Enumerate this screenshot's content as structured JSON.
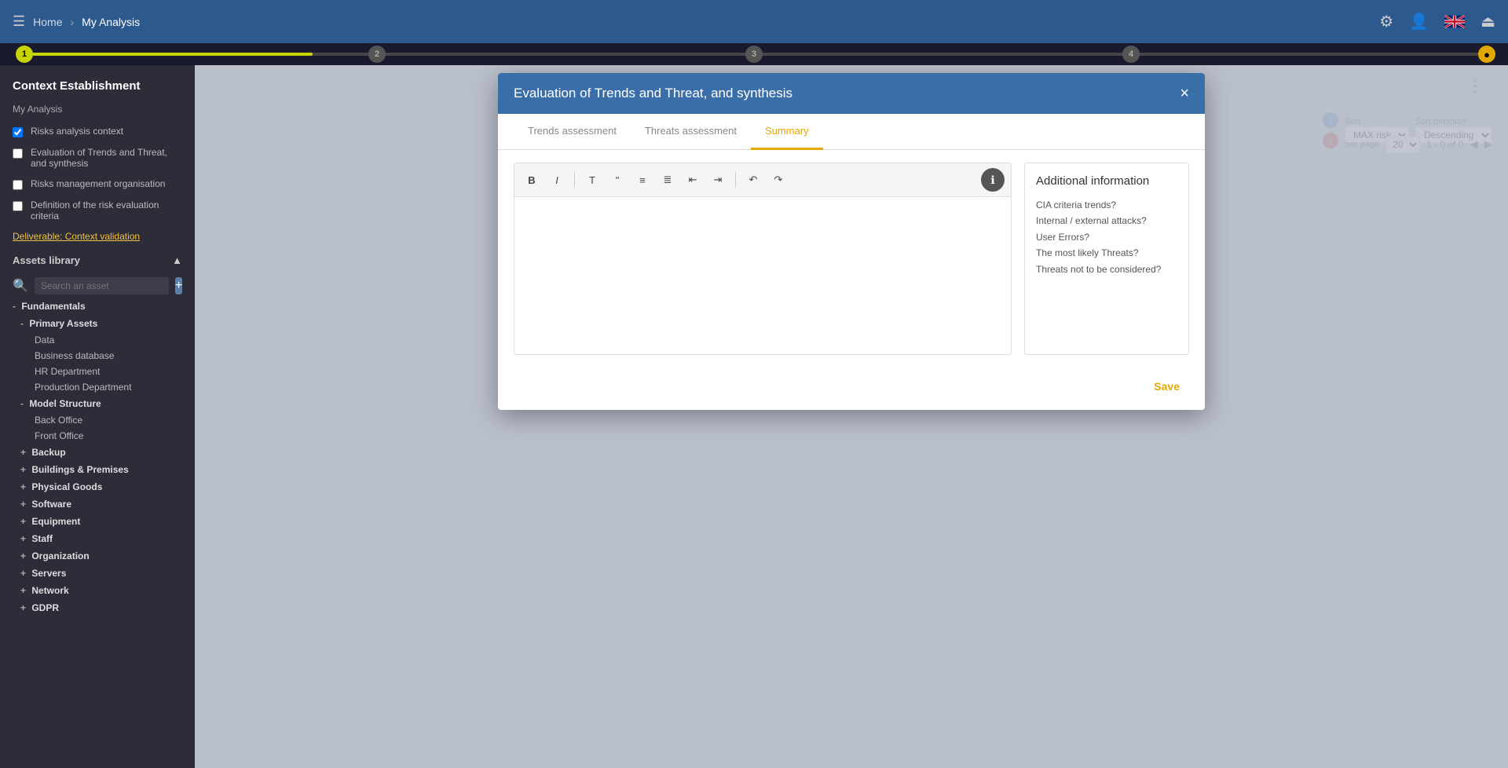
{
  "app": {
    "title": "My Analysis",
    "home_label": "Home",
    "breadcrumb_sep": "›"
  },
  "nav_icons": {
    "settings": "⚙",
    "user": "👤",
    "logout": "⏏"
  },
  "progress": {
    "steps": [
      {
        "label": "1",
        "state": "active"
      },
      {
        "label": "2",
        "state": "inactive"
      },
      {
        "label": "3",
        "state": "inactive"
      },
      {
        "label": "4",
        "state": "inactive"
      },
      {
        "label": "●",
        "state": "warning"
      }
    ]
  },
  "sidebar": {
    "section_title": "Context Establishment",
    "my_analysis_label": "My Analysis",
    "items": [
      {
        "label": "Risks analysis context",
        "checked": true
      },
      {
        "label": "Evaluation of Trends and Threat, and synthesis",
        "checked": false
      },
      {
        "label": "Risks management organisation",
        "checked": false
      },
      {
        "label": "Definition of the risk evaluation criteria",
        "checked": false
      }
    ],
    "deliverable": "Deliverable: Context validation",
    "assets_header": "Assets library",
    "search_placeholder": "Search an asset",
    "tree": [
      {
        "label": "Fundamentals",
        "type": "parent",
        "indent": 0
      },
      {
        "label": "Primary Assets",
        "type": "parent",
        "indent": 1
      },
      {
        "label": "Data",
        "type": "leaf",
        "indent": 2
      },
      {
        "label": "Business database",
        "type": "leaf",
        "indent": 2
      },
      {
        "label": "HR Department",
        "type": "leaf",
        "indent": 2
      },
      {
        "label": "Production Department",
        "type": "leaf",
        "indent": 2
      },
      {
        "label": "Model Structure",
        "type": "parent",
        "indent": 1
      },
      {
        "label": "Back Office",
        "type": "leaf",
        "indent": 2
      },
      {
        "label": "Front Office",
        "type": "leaf",
        "indent": 2
      },
      {
        "label": "Backup",
        "type": "parent-collapsed",
        "indent": 1
      },
      {
        "label": "Buildings & Premises",
        "type": "parent-collapsed",
        "indent": 1
      },
      {
        "label": "Physical Goods",
        "type": "parent-collapsed",
        "indent": 1
      },
      {
        "label": "Software",
        "type": "parent-collapsed",
        "indent": 1
      },
      {
        "label": "Equipment",
        "type": "parent-collapsed",
        "indent": 1
      },
      {
        "label": "Staff",
        "type": "parent-collapsed",
        "indent": 1
      },
      {
        "label": "Organization",
        "type": "parent-collapsed",
        "indent": 1
      },
      {
        "label": "Servers",
        "type": "parent-collapsed",
        "indent": 1
      },
      {
        "label": "Network",
        "type": "parent-collapsed",
        "indent": 1
      },
      {
        "label": "GDPR",
        "type": "parent-collapsed",
        "indent": 1
      }
    ]
  },
  "modal": {
    "title": "Evaluation of Trends and Threat, and synthesis",
    "tabs": [
      {
        "label": "Trends assessment",
        "active": false
      },
      {
        "label": "Threats assessment",
        "active": false
      },
      {
        "label": "Summary",
        "active": true
      }
    ],
    "close_label": "×",
    "toolbar": {
      "bold": "B",
      "italic": "I",
      "format": "T",
      "quote": "\"",
      "list_ul": "≡",
      "list_ol": "≣",
      "indent_dec": "⇤",
      "indent_inc": "⇥",
      "undo": "↶",
      "redo": "↷",
      "info": "ℹ"
    },
    "editor_placeholder": "",
    "additional_info": {
      "title": "Additional information",
      "lines": [
        "CIA criteria trends?",
        "Internal / external attacks?",
        "User Errors?",
        "The most likely Threats?",
        "Threats not to be considered?"
      ]
    },
    "save_label": "Save"
  },
  "background": {
    "card_title": "My Analysis",
    "sort_label": "Sort",
    "sort_direction_label": "Sort direction",
    "sort_value": "MAX risk",
    "sort_direction_value": "Descending",
    "pagination": "1 - 0 of 0",
    "per_page": "20"
  }
}
